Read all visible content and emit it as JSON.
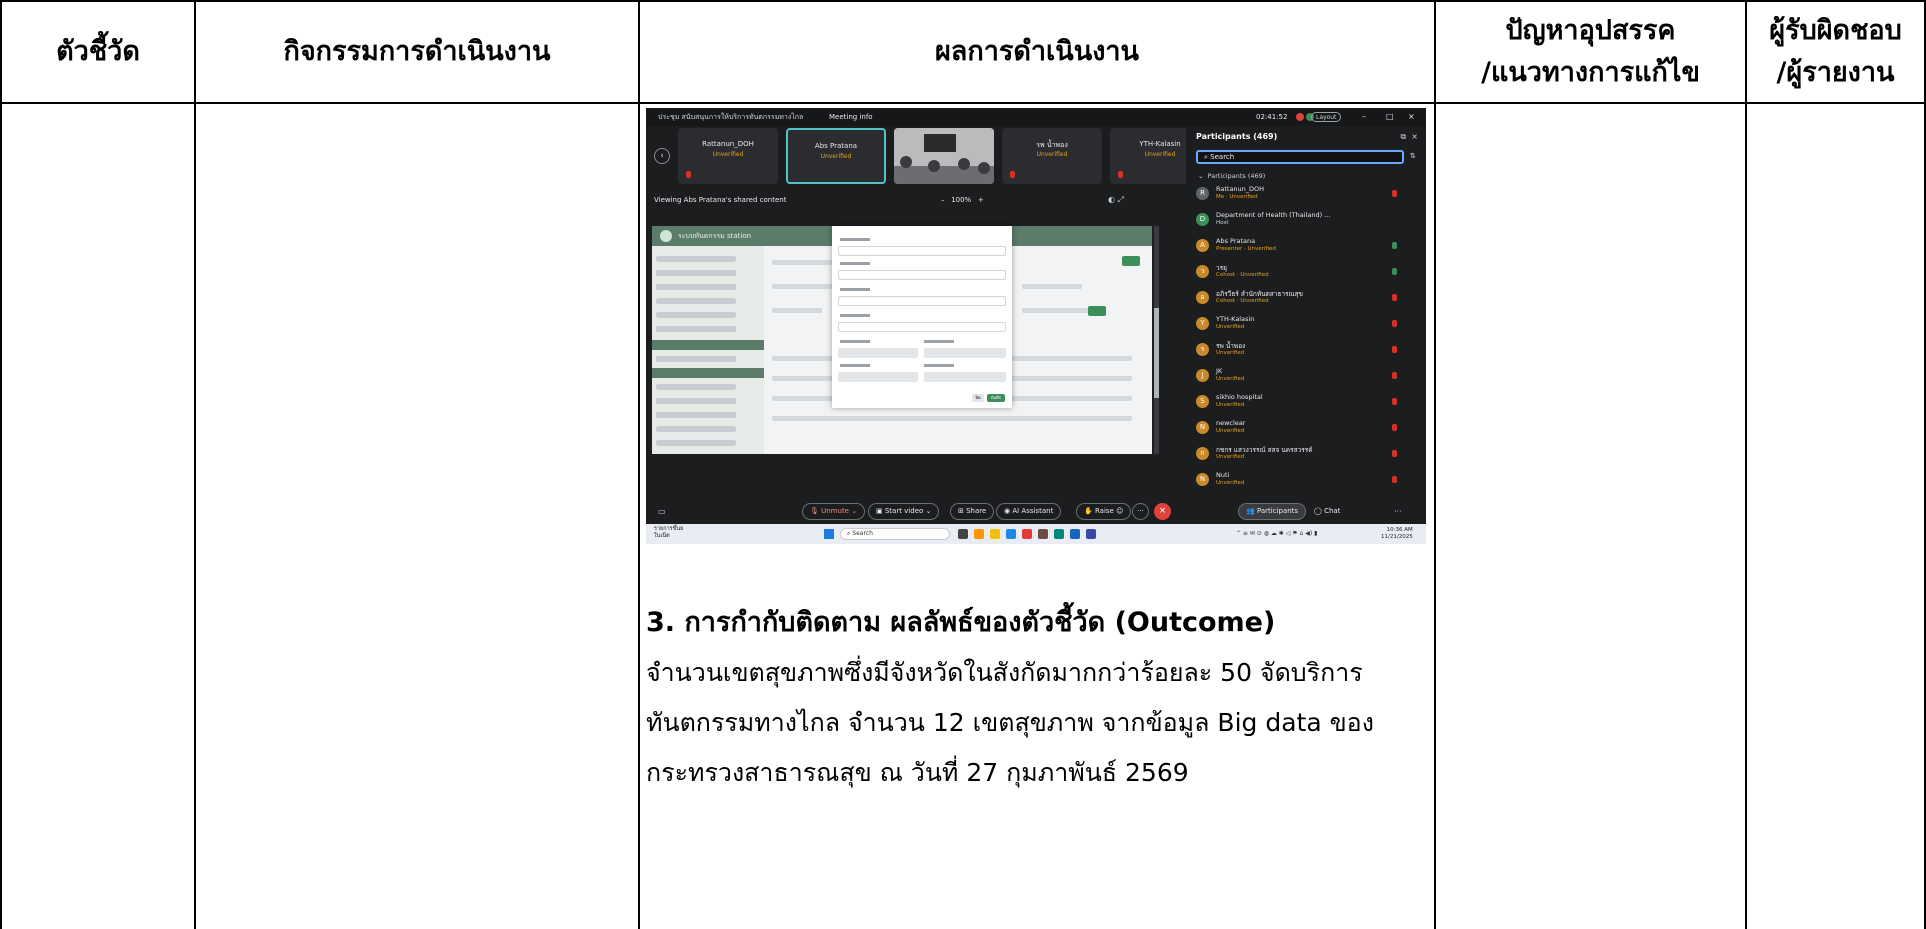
{
  "table": {
    "headers": {
      "indicator": "ตัวชี้วัด",
      "activities": "กิจกรรมการดำเนินงาน",
      "results": "ผลการดำเนินงาน",
      "problems_line1": "ปัญหาอุปสรรค",
      "problems_line2": "/แนวทางการแก้ไข",
      "responsible_line1": "ผู้รับผิดชอบ",
      "responsible_line2": "/ผู้รายงาน"
    }
  },
  "screenshot": {
    "meeting_info": "Meeting info",
    "window_title": "ประชุม สนับสนุนการให้บริการทันตกรรมทางไกล",
    "clock": "02:41:52",
    "layout_label": "Layout",
    "tiles": [
      {
        "name": "Rattanun_DOH",
        "status": "Unverified"
      },
      {
        "name": "Abs Pratana",
        "status": "Unverified"
      },
      {
        "name": "",
        "status": ""
      },
      {
        "name": "รพ น้ำพอง",
        "status": "Unverified"
      },
      {
        "name": "YTH-Kalasin",
        "status": "Unverified"
      }
    ],
    "viewing_label": "Viewing Abs Pratana's shared content",
    "zoom_level": "100%",
    "shared_app_name": "ระบบทันตกรรม station",
    "modal_save": "บันทึก",
    "modal_cancel": "ปิด",
    "participants": {
      "title": "Participants (469)",
      "search_placeholder": "Search",
      "group_label": "Participants (469)",
      "list": [
        {
          "name": "Rattanun_DOH",
          "status": "Me · Unverified",
          "initial": "R",
          "color": "#5f6368"
        },
        {
          "name": "Department of Health (Thailand) ...",
          "status": "Host",
          "initial": "D",
          "color": "#3c8f5a"
        },
        {
          "name": "Abs Pratana",
          "status": "Presenter · Unverified",
          "initial": "A",
          "color": "#c98a2b"
        },
        {
          "name": "วรยุ",
          "status": "Cohost · Unverified",
          "initial": "ว",
          "color": "#c98a2b"
        },
        {
          "name": "อภิรวีธร์ สำนักทันตสาธารณสุข",
          "status": "Cohost · Unverified",
          "initial": "อ",
          "color": "#c98a2b"
        },
        {
          "name": "YTH-Kalasin",
          "status": "Unverified",
          "initial": "Y",
          "color": "#c98a2b"
        },
        {
          "name": "รพ น้ำพอง",
          "status": "Unverified",
          "initial": "ร",
          "color": "#c98a2b"
        },
        {
          "name": "JK",
          "status": "Unverified",
          "initial": "J",
          "color": "#c98a2b"
        },
        {
          "name": "sikhio hospital",
          "status": "Unverified",
          "initial": "S",
          "color": "#c98a2b"
        },
        {
          "name": "newclear",
          "status": "Unverified",
          "initial": "N",
          "color": "#c98a2b"
        },
        {
          "name": "กชกร แสวงวรรณ์ สสจ นครสวรรค์",
          "status": "Unverified",
          "initial": "ก",
          "color": "#c98a2b"
        },
        {
          "name": "Nuti",
          "status": "Unverified",
          "initial": "N",
          "color": "#c98a2b"
        }
      ]
    },
    "toolbar": {
      "unmute": "Unmute",
      "start_video": "Start video",
      "share": "Share",
      "ai_assistant": "AI Assistant",
      "raise": "Raise",
      "participants": "Participants",
      "chat": "Chat"
    },
    "taskbar": {
      "weather_line1": "รายการขึ้นย",
      "weather_line2": "ในเน็ต",
      "search": "Search",
      "time": "10:36 AM",
      "date": "11/21/2025"
    }
  },
  "outcome": {
    "heading": "3. การกำกับติดตาม ผลลัพธ์ของตัวชี้วัด (Outcome)",
    "lines": [
      "จำนวนเขตสุขภาพซึ่งมีจังหวัดในสังกัดมากกว่าร้อยละ 50 จัดบริการ",
      "ทันตกรรมทางไกล จำนวน 12 เขตสุขภาพ จากข้อมูล Big data ของ",
      "กระทรวงสาธารณสุข ณ วันที่ 27 กุมภาพันธ์ 2569"
    ]
  }
}
